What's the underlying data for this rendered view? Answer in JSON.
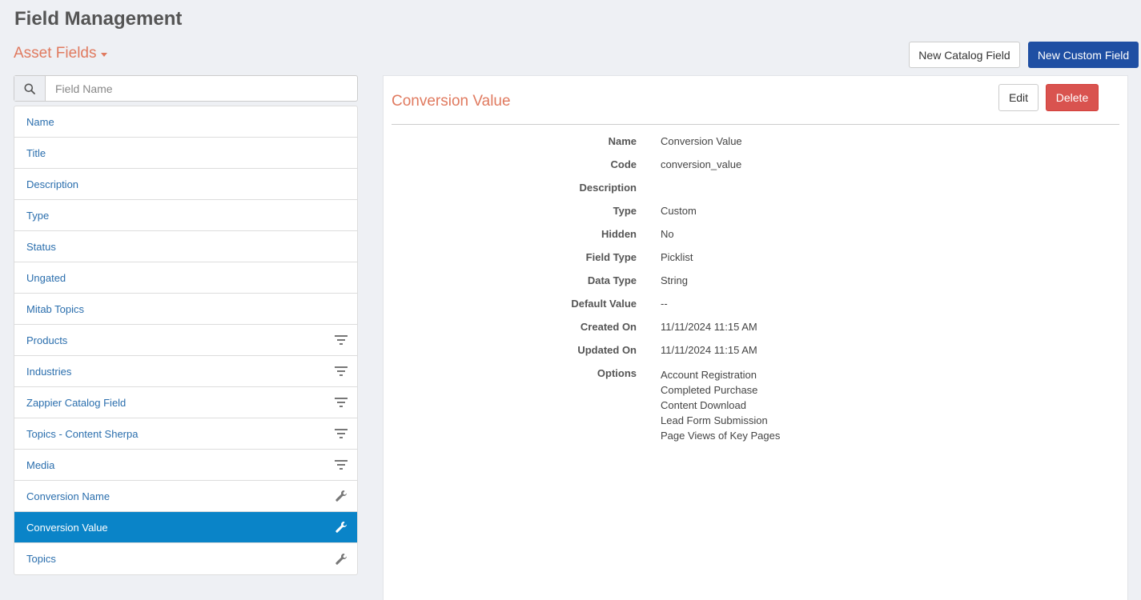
{
  "header": {
    "title": "Field Management",
    "section": "Asset Fields",
    "new_catalog_label": "New Catalog Field",
    "new_custom_label": "New Custom Field"
  },
  "search": {
    "placeholder": "Field Name",
    "value": ""
  },
  "fields": [
    {
      "label": "Name",
      "icon": ""
    },
    {
      "label": "Title",
      "icon": ""
    },
    {
      "label": "Description",
      "icon": ""
    },
    {
      "label": "Type",
      "icon": ""
    },
    {
      "label": "Status",
      "icon": ""
    },
    {
      "label": "Ungated",
      "icon": ""
    },
    {
      "label": "Mitab Topics",
      "icon": ""
    },
    {
      "label": "Products",
      "icon": "filter-icon"
    },
    {
      "label": "Industries",
      "icon": "filter-icon"
    },
    {
      "label": "Zappier Catalog Field",
      "icon": "filter-icon"
    },
    {
      "label": "Topics - Content Sherpa",
      "icon": "filter-icon"
    },
    {
      "label": "Media",
      "icon": "filter-icon"
    },
    {
      "label": "Conversion Name",
      "icon": "wrench-icon"
    },
    {
      "label": "Conversion Value",
      "icon": "wrench-icon",
      "selected": true
    },
    {
      "label": "Topics",
      "icon": "wrench-icon"
    }
  ],
  "detail": {
    "title": "Conversion Value",
    "edit_label": "Edit",
    "delete_label": "Delete",
    "properties": [
      {
        "label": "Name",
        "value": "Conversion Value"
      },
      {
        "label": "Code",
        "value": "conversion_value"
      },
      {
        "label": "Description",
        "value": ""
      },
      {
        "label": "Type",
        "value": "Custom"
      },
      {
        "label": "Hidden",
        "value": "No"
      },
      {
        "label": "Field Type",
        "value": "Picklist"
      },
      {
        "label": "Data Type",
        "value": "String"
      },
      {
        "label": "Default Value",
        "value": "--"
      },
      {
        "label": "Created On",
        "value": "11/11/2024 11:15 AM"
      },
      {
        "label": "Updated On",
        "value": "11/11/2024 11:15 AM"
      }
    ],
    "options_label": "Options",
    "options": [
      "Account Registration",
      "Completed Purchase",
      "Content Download",
      "Lead Form Submission",
      "Page Views of Key Pages"
    ]
  },
  "colors": {
    "accent": "#e07a5f",
    "primary_button": "#1f4fa3",
    "delete_button": "#d9534f",
    "selected_row": "#0a84c8",
    "link": "#2a6ead"
  }
}
